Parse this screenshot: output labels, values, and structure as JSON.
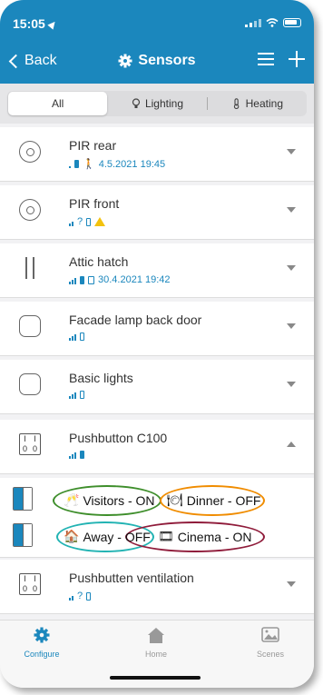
{
  "status_bar": {
    "time": "15:05"
  },
  "header": {
    "back_label": "Back",
    "title": "Sensors"
  },
  "segments": [
    {
      "label": "All",
      "active": true
    },
    {
      "label": "Lighting",
      "active": false
    },
    {
      "label": "Heating",
      "active": false
    }
  ],
  "devices": [
    {
      "name": "PIR rear",
      "meta": "4.5.2021 19:45"
    },
    {
      "name": "PIR front",
      "meta": "?"
    },
    {
      "name": "Attic hatch",
      "meta": "30.4.2021 19:42"
    },
    {
      "name": "Facade lamp back door",
      "meta": ""
    },
    {
      "name": "Basic lights",
      "meta": ""
    },
    {
      "name": "Pushbutton C100",
      "meta": ""
    },
    {
      "name": "Pushbutten ventilation",
      "meta": "?"
    }
  ],
  "pushbutton_icon": {
    "top_left": "I",
    "top_right": "I",
    "bottom_left": "0",
    "bottom_right": "0"
  },
  "actions": [
    {
      "label": "Visitors - ON",
      "icon": "cheers-icon"
    },
    {
      "label": "Dinner - OFF",
      "icon": "dinner-icon"
    },
    {
      "label": "Away - OFF",
      "icon": "house-icon"
    },
    {
      "label": "Cinema - ON",
      "icon": "film-icon"
    }
  ],
  "oval_colors": {
    "visitors": "#3e8e2b",
    "dinner": "#f08c00",
    "away": "#22b3b3",
    "cinema": "#8f1b3a"
  },
  "tabs": [
    {
      "label": "Configure",
      "active": true
    },
    {
      "label": "Home",
      "active": false
    },
    {
      "label": "Scenes",
      "active": false
    }
  ],
  "colors": {
    "accent": "#1b87bd",
    "warning": "#f3c20e"
  }
}
